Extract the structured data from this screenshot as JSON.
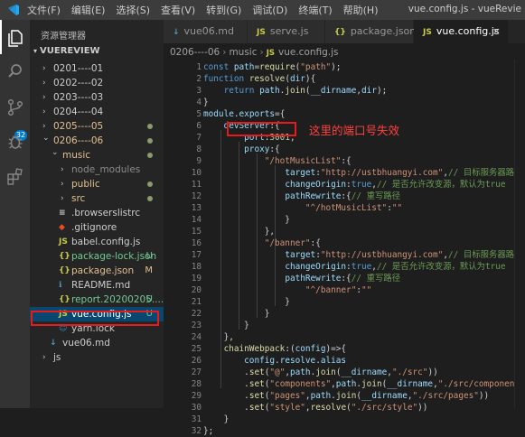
{
  "titlebar": {
    "menus": [
      "文件(F)",
      "编辑(E)",
      "选择(S)",
      "查看(V)",
      "转到(G)",
      "调试(D)",
      "终端(T)",
      "帮助(H)"
    ],
    "window_title": "vue.config.js - vueRevie"
  },
  "activity_bar": {
    "icons": [
      "files-icon",
      "search-icon",
      "source-control-icon",
      "debug-icon",
      "extensions-icon"
    ],
    "scm_badge": "32"
  },
  "sidebar": {
    "title": "资源管理器",
    "section": "VUEREVIEW",
    "items": [
      {
        "label": "0201----01",
        "kind": "folder",
        "expanded": false,
        "status": "",
        "color": "#cccccc"
      },
      {
        "label": "0202----02",
        "kind": "folder",
        "expanded": false,
        "status": "",
        "color": "#cccccc"
      },
      {
        "label": "0203----03",
        "kind": "folder",
        "expanded": false,
        "status": "",
        "color": "#cccccc"
      },
      {
        "label": "0204----04",
        "kind": "folder",
        "expanded": false,
        "status": "",
        "color": "#cccccc"
      },
      {
        "label": "0205----05",
        "kind": "folder",
        "expanded": false,
        "status": "dot",
        "color": "#e2c08d"
      },
      {
        "label": "0206----06",
        "kind": "folder",
        "expanded": true,
        "status": "dot",
        "color": "#e2c08d"
      },
      {
        "label": "music",
        "kind": "folder",
        "expanded": true,
        "status": "dot",
        "color": "#e2c08d"
      },
      {
        "label": "node_modules",
        "kind": "folder",
        "expanded": false,
        "status": "",
        "color": "#8c8c8c"
      },
      {
        "label": "public",
        "kind": "folder",
        "expanded": false,
        "status": "dot",
        "color": "#e2c08d"
      },
      {
        "label": "src",
        "kind": "folder",
        "expanded": false,
        "status": "dot",
        "color": "#e2c08d"
      },
      {
        "label": ".browserslistrc",
        "kind": "file",
        "icon": "≡",
        "icon_color": "#cccccc",
        "status": "",
        "color": "#cccccc"
      },
      {
        "label": ".gitignore",
        "kind": "file",
        "icon": "◆",
        "icon_color": "#e44d26",
        "status": "",
        "color": "#cccccc"
      },
      {
        "label": "babel.config.js",
        "kind": "file",
        "icon": "JS",
        "icon_color": "#cbcb41",
        "status": "",
        "color": "#cccccc"
      },
      {
        "label": "package-lock.json",
        "kind": "file",
        "icon": "{}",
        "icon_color": "#cbcb41",
        "status": "U",
        "color": "#73c991"
      },
      {
        "label": "package.json",
        "kind": "file",
        "icon": "{}",
        "icon_color": "#cbcb41",
        "status": "M",
        "color": "#e2c08d"
      },
      {
        "label": "README.md",
        "kind": "file",
        "icon": "ℹ",
        "icon_color": "#519aba",
        "status": "",
        "color": "#cccccc"
      },
      {
        "label": "report.20200205....",
        "kind": "file",
        "icon": "{}",
        "icon_color": "#cbcb41",
        "status": "U",
        "color": "#73c991"
      },
      {
        "label": "vue.config.js",
        "kind": "file",
        "icon": "JS",
        "icon_color": "#cbcb41",
        "status": "U",
        "color": "#ffffff",
        "selected": true
      },
      {
        "label": "yarn.lock",
        "kind": "file",
        "icon": "☺",
        "icon_color": "#2c8ebb",
        "status": "",
        "color": "#cccccc"
      },
      {
        "label": "vue06.md",
        "kind": "file",
        "icon": "↓",
        "icon_color": "#519aba",
        "status": "",
        "color": "#cccccc"
      },
      {
        "label": "js",
        "kind": "folder",
        "expanded": false,
        "status": "",
        "color": "#cccccc"
      }
    ]
  },
  "tabs": [
    {
      "label": "vue06.md",
      "icon": "↓",
      "icon_color": "#519aba",
      "active": false
    },
    {
      "label": "serve.js",
      "icon": "JS",
      "icon_color": "#cbcb41",
      "active": false
    },
    {
      "label": "package.json",
      "icon": "{}",
      "icon_color": "#cbcb41",
      "active": false
    },
    {
      "label": "vue.config.js",
      "icon": "JS",
      "icon_color": "#cbcb41",
      "active": true,
      "close": "×"
    }
  ],
  "breadcrumb": [
    "0206----06",
    "music",
    "vue.config.js"
  ],
  "breadcrumb_icon": "JS",
  "editor": {
    "lines": [
      [
        [
          "kw",
          "const "
        ],
        [
          "var",
          "path"
        ],
        [
          "",
          "="
        ],
        [
          "fn",
          "require"
        ],
        [
          "",
          "("
        ],
        [
          "str",
          "\"path\""
        ],
        [
          "",
          ");"
        ]
      ],
      [
        [
          "kw",
          "function "
        ],
        [
          "fn",
          "resolve"
        ],
        [
          "",
          "("
        ],
        [
          "var",
          "dir"
        ],
        [
          "",
          "){"
        ]
      ],
      [
        [
          "",
          "    "
        ],
        [
          "kw",
          "return "
        ],
        [
          "var",
          "path"
        ],
        [
          "",
          "."
        ],
        [
          "fn",
          "join"
        ],
        [
          "",
          "("
        ],
        [
          "var",
          "__dirname"
        ],
        [
          "",
          ","
        ],
        [
          "var",
          "dir"
        ],
        [
          "",
          ");"
        ]
      ],
      [
        [
          "",
          "}"
        ]
      ],
      [
        [
          "var",
          "module"
        ],
        [
          "",
          "."
        ],
        [
          "var",
          "exports"
        ],
        [
          "",
          "={"
        ]
      ],
      [
        [
          "",
          "    "
        ],
        [
          "var",
          "devServer"
        ],
        [
          "",
          ":{"
        ]
      ],
      [
        [
          "",
          "        "
        ],
        [
          "var",
          "port"
        ],
        [
          "",
          ":"
        ],
        [
          "num",
          "3001"
        ],
        [
          "",
          ","
        ]
      ],
      [
        [
          "",
          "        "
        ],
        [
          "var",
          "proxy"
        ],
        [
          "",
          ":{"
        ]
      ],
      [
        [
          "",
          "            "
        ],
        [
          "str",
          "\"/hotMusicList\""
        ],
        [
          "",
          ":{"
        ]
      ],
      [
        [
          "",
          "                "
        ],
        [
          "var",
          "target"
        ],
        [
          "",
          ":"
        ],
        [
          "str",
          "\"http://ustbhuangyi.com\""
        ],
        [
          "",
          ","
        ],
        [
          "com",
          "// 目标服务器路径"
        ]
      ],
      [
        [
          "",
          "                "
        ],
        [
          "var",
          "changeOrigin"
        ],
        [
          "",
          ":"
        ],
        [
          "kw",
          "true"
        ],
        [
          "",
          ","
        ],
        [
          "com",
          "// 是否允许改变源，默认为true"
        ]
      ],
      [
        [
          "",
          "                "
        ],
        [
          "var",
          "pathRewrite"
        ],
        [
          "",
          ":{"
        ],
        [
          "com",
          "// 重写路径"
        ]
      ],
      [
        [
          "",
          "                    "
        ],
        [
          "str",
          "\"^/hotMusicList\""
        ],
        [
          "",
          ":"
        ],
        [
          "str",
          "\"\""
        ]
      ],
      [
        [
          "",
          "                }"
        ]
      ],
      [
        [
          "",
          "            },"
        ]
      ],
      [
        [
          "",
          "            "
        ],
        [
          "str",
          "\"/banner\""
        ],
        [
          "",
          ":{"
        ]
      ],
      [
        [
          "",
          "                "
        ],
        [
          "var",
          "target"
        ],
        [
          "",
          ":"
        ],
        [
          "str",
          "\"http://ustbhuangyi.com\""
        ],
        [
          "",
          ","
        ],
        [
          "com",
          "// 目标服务器路径"
        ]
      ],
      [
        [
          "",
          "                "
        ],
        [
          "var",
          "changeOrigin"
        ],
        [
          "",
          ":"
        ],
        [
          "kw",
          "true"
        ],
        [
          "",
          ","
        ],
        [
          "com",
          "// 是否允许改变源，默认为true"
        ]
      ],
      [
        [
          "",
          "                "
        ],
        [
          "var",
          "pathRewrite"
        ],
        [
          "",
          ":{"
        ],
        [
          "com",
          "// 重写路径"
        ]
      ],
      [
        [
          "",
          "                    "
        ],
        [
          "str",
          "\"^/banner\""
        ],
        [
          "",
          ":"
        ],
        [
          "str",
          "\"\""
        ]
      ],
      [
        [
          "",
          "                }"
        ]
      ],
      [
        [
          "",
          "            }"
        ]
      ],
      [
        [
          "",
          "        }"
        ]
      ],
      [
        [
          "",
          "    },"
        ]
      ],
      [
        [
          "",
          "    "
        ],
        [
          "fn",
          "chainWebpack"
        ],
        [
          "",
          ":("
        ],
        [
          "var",
          "config"
        ],
        [
          "",
          ")=>{"
        ]
      ],
      [
        [
          "",
          "        "
        ],
        [
          "var",
          "config"
        ],
        [
          "",
          "."
        ],
        [
          "var",
          "resolve"
        ],
        [
          "",
          "."
        ],
        [
          "var",
          "alias"
        ]
      ],
      [
        [
          "",
          "        ."
        ],
        [
          "fn",
          "set"
        ],
        [
          "",
          "("
        ],
        [
          "str",
          "\"@\""
        ],
        [
          "",
          ","
        ],
        [
          "var",
          "path"
        ],
        [
          "",
          "."
        ],
        [
          "fn",
          "join"
        ],
        [
          "",
          "("
        ],
        [
          "var",
          "__dirname"
        ],
        [
          "",
          ","
        ],
        [
          "str",
          "\"./src\""
        ],
        [
          "",
          "))"
        ]
      ],
      [
        [
          "",
          "        ."
        ],
        [
          "fn",
          "set"
        ],
        [
          "",
          "("
        ],
        [
          "str",
          "\"components\""
        ],
        [
          "",
          ","
        ],
        [
          "var",
          "path"
        ],
        [
          "",
          "."
        ],
        [
          "fn",
          "join"
        ],
        [
          "",
          "("
        ],
        [
          "var",
          "__dirname"
        ],
        [
          "",
          ","
        ],
        [
          "str",
          "\"./src/components\""
        ],
        [
          "",
          "))"
        ]
      ],
      [
        [
          "",
          "        ."
        ],
        [
          "fn",
          "set"
        ],
        [
          "",
          "("
        ],
        [
          "str",
          "\"pages\""
        ],
        [
          "",
          ","
        ],
        [
          "var",
          "path"
        ],
        [
          "",
          "."
        ],
        [
          "fn",
          "join"
        ],
        [
          "",
          "("
        ],
        [
          "var",
          "__dirname"
        ],
        [
          "",
          ","
        ],
        [
          "str",
          "\"./src/pages\""
        ],
        [
          "",
          "))"
        ]
      ],
      [
        [
          "",
          "        ."
        ],
        [
          "fn",
          "set"
        ],
        [
          "",
          "("
        ],
        [
          "str",
          "\"style\""
        ],
        [
          "",
          ","
        ],
        [
          "fn",
          "resolve"
        ],
        [
          "",
          "("
        ],
        [
          "str",
          "\"./src/style\""
        ],
        [
          "",
          "))"
        ]
      ],
      [
        [
          "",
          "    }"
        ]
      ],
      [
        [
          "",
          "};"
        ]
      ]
    ]
  },
  "annotation": {
    "text": "这里的端口号失效"
  }
}
